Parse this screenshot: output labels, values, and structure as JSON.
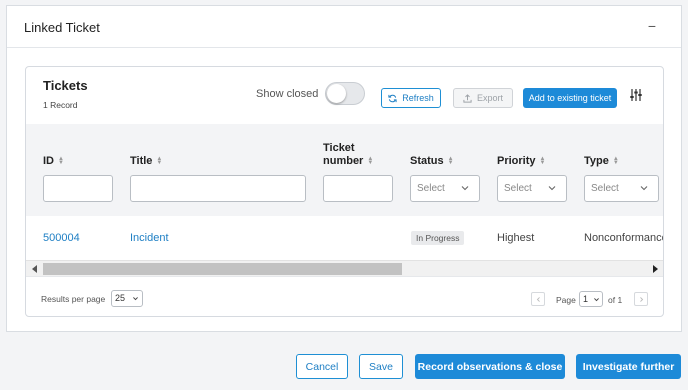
{
  "panel": {
    "title": "Linked Ticket",
    "collapse_symbol": "−"
  },
  "card": {
    "title": "Tickets",
    "record_count": "1 Record",
    "show_closed_label": "Show closed",
    "show_closed_on": false,
    "refresh_label": "Refresh",
    "export_label": "Export",
    "add_existing_label": "Add to existing ticket",
    "settings_icon": "sliders-icon"
  },
  "table": {
    "columns": [
      {
        "label": "ID"
      },
      {
        "label": "Title"
      },
      {
        "label": "Ticket number"
      },
      {
        "label": "Status"
      },
      {
        "label": "Priority"
      },
      {
        "label": "Type"
      }
    ],
    "select_placeholder": "Select",
    "rows": [
      {
        "id": "500004",
        "title": "Incident",
        "ticket_number": "",
        "status": "In Progress",
        "priority": "Highest",
        "type": "Nonconformance"
      }
    ]
  },
  "pagination": {
    "results_per_page_label": "Results per page",
    "results_per_page": "25",
    "page_label": "Page",
    "page": "1",
    "of_label": "of 1"
  },
  "actions": {
    "cancel": "Cancel",
    "save": "Save",
    "record_close": "Record observations & close",
    "investigate": "Investigate further"
  },
  "colors": {
    "accent": "#1d8ad8",
    "link": "#1e7fc4"
  }
}
